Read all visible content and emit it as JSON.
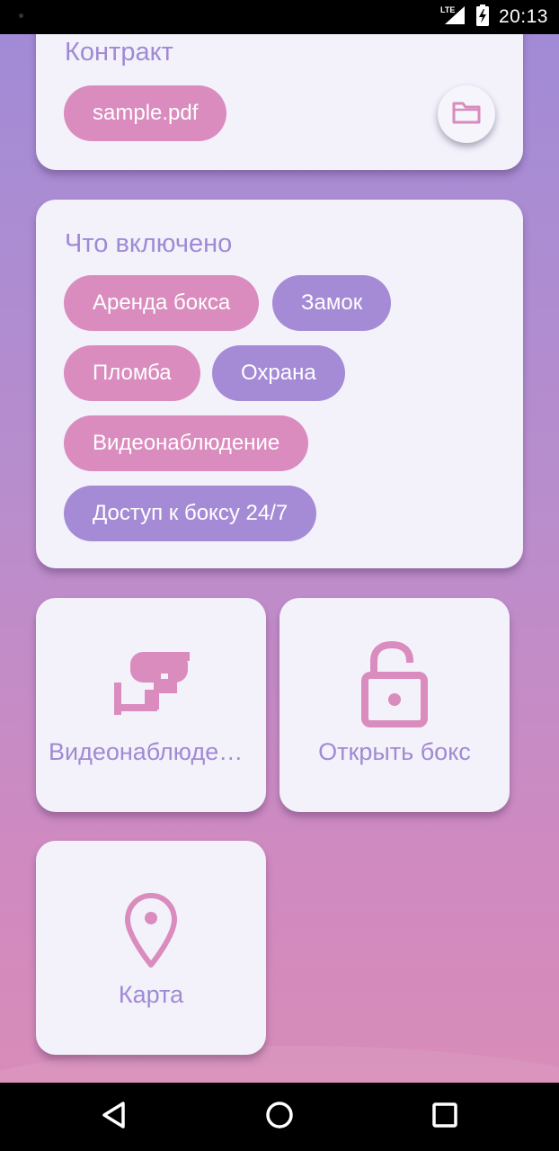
{
  "status_bar": {
    "network": "LTE",
    "time": "20:13"
  },
  "contract_card": {
    "title": "Контракт",
    "file_chip": "sample.pdf",
    "folder_icon": "folder-icon"
  },
  "included_card": {
    "title": "Что включено",
    "chips": [
      {
        "label": "Аренда бокса",
        "color": "pink"
      },
      {
        "label": "Замок",
        "color": "purple"
      },
      {
        "label": "Пломба",
        "color": "pink"
      },
      {
        "label": "Охрана",
        "color": "purple"
      },
      {
        "label": "Видеонаблюдение",
        "color": "pink"
      },
      {
        "label": "Доступ к боксу 24/7",
        "color": "purple"
      }
    ]
  },
  "tiles": [
    {
      "label": "Видеонаблюдение",
      "icon": "cctv-camera-icon"
    },
    {
      "label": "Открыть бокс",
      "icon": "lock-open-icon"
    },
    {
      "label": "Карта",
      "icon": "map-marker-icon"
    }
  ],
  "colors": {
    "pink": "#da8cbe",
    "purple": "#a58bd6",
    "text_accent": "#a08ad4",
    "card_bg": "#f3f2fb"
  }
}
